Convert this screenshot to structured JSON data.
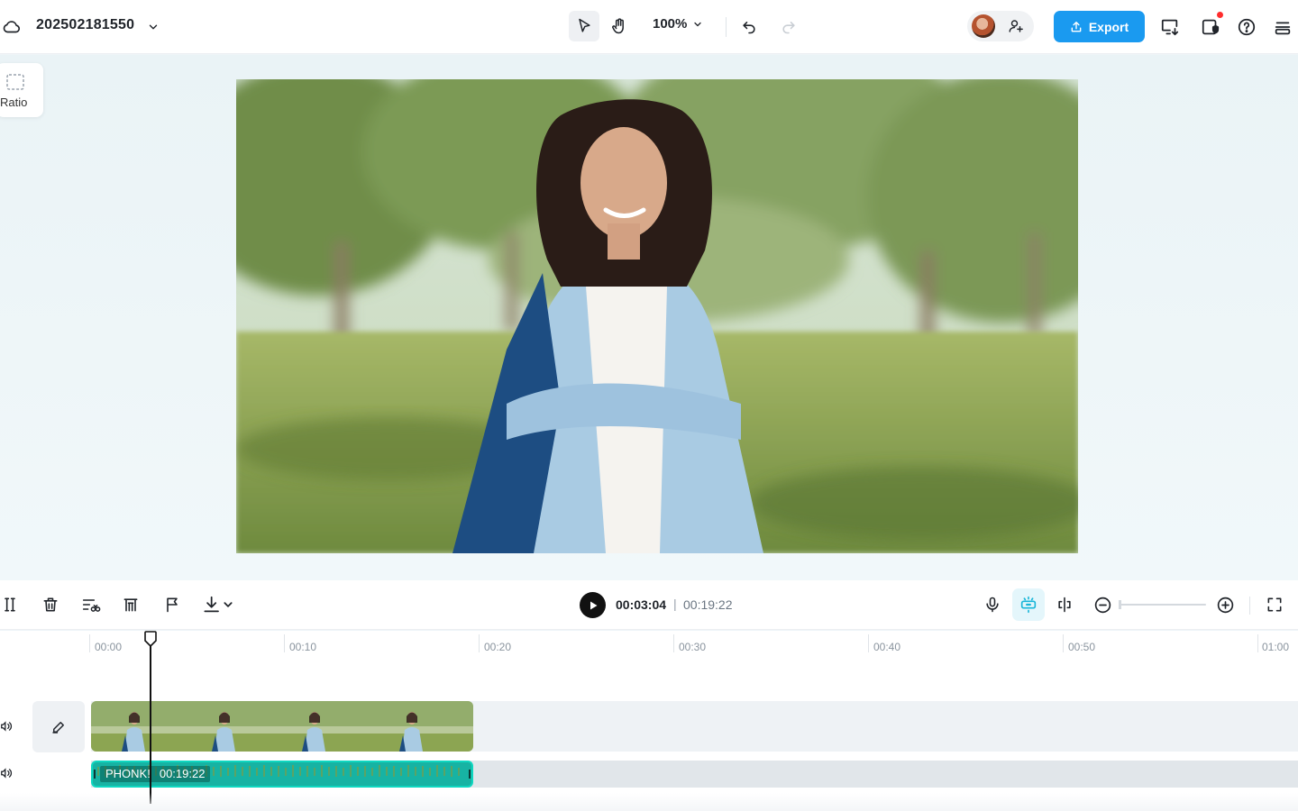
{
  "header": {
    "project_title": "202502181550",
    "zoom_level": "100%",
    "export_label": "Export",
    "icons": [
      "cloud-icon",
      "chevron-down-icon",
      "select-pointer-icon",
      "hand-icon",
      "undo-icon",
      "redo-icon",
      "add-collaborator-icon",
      "upload-icon",
      "screen-download-icon",
      "device-shield-icon",
      "help-icon",
      "layers-menu-icon"
    ]
  },
  "canvas": {
    "ratio_label": "Ratio"
  },
  "timeline_toolbar": {
    "current_time": "00:03:04",
    "separator": "|",
    "total_time": "00:19:22",
    "icons": [
      "split-icon",
      "delete-icon",
      "trim-icon",
      "freeze-frame-icon",
      "marker-flag-icon",
      "download-icon",
      "play-icon",
      "microphone-icon",
      "ai-enhance-icon",
      "split-screen-icon",
      "zoom-out-icon",
      "zoom-in-icon",
      "fullscreen-icon"
    ]
  },
  "timeline": {
    "ruler": [
      "00:00",
      "00:10",
      "00:20",
      "00:30",
      "00:40",
      "00:50",
      "01:00"
    ],
    "audio_clip": {
      "name": "PHONK!",
      "duration": "00:19:22"
    },
    "accent": "#17b3a3",
    "export_color": "#1a9af0"
  }
}
